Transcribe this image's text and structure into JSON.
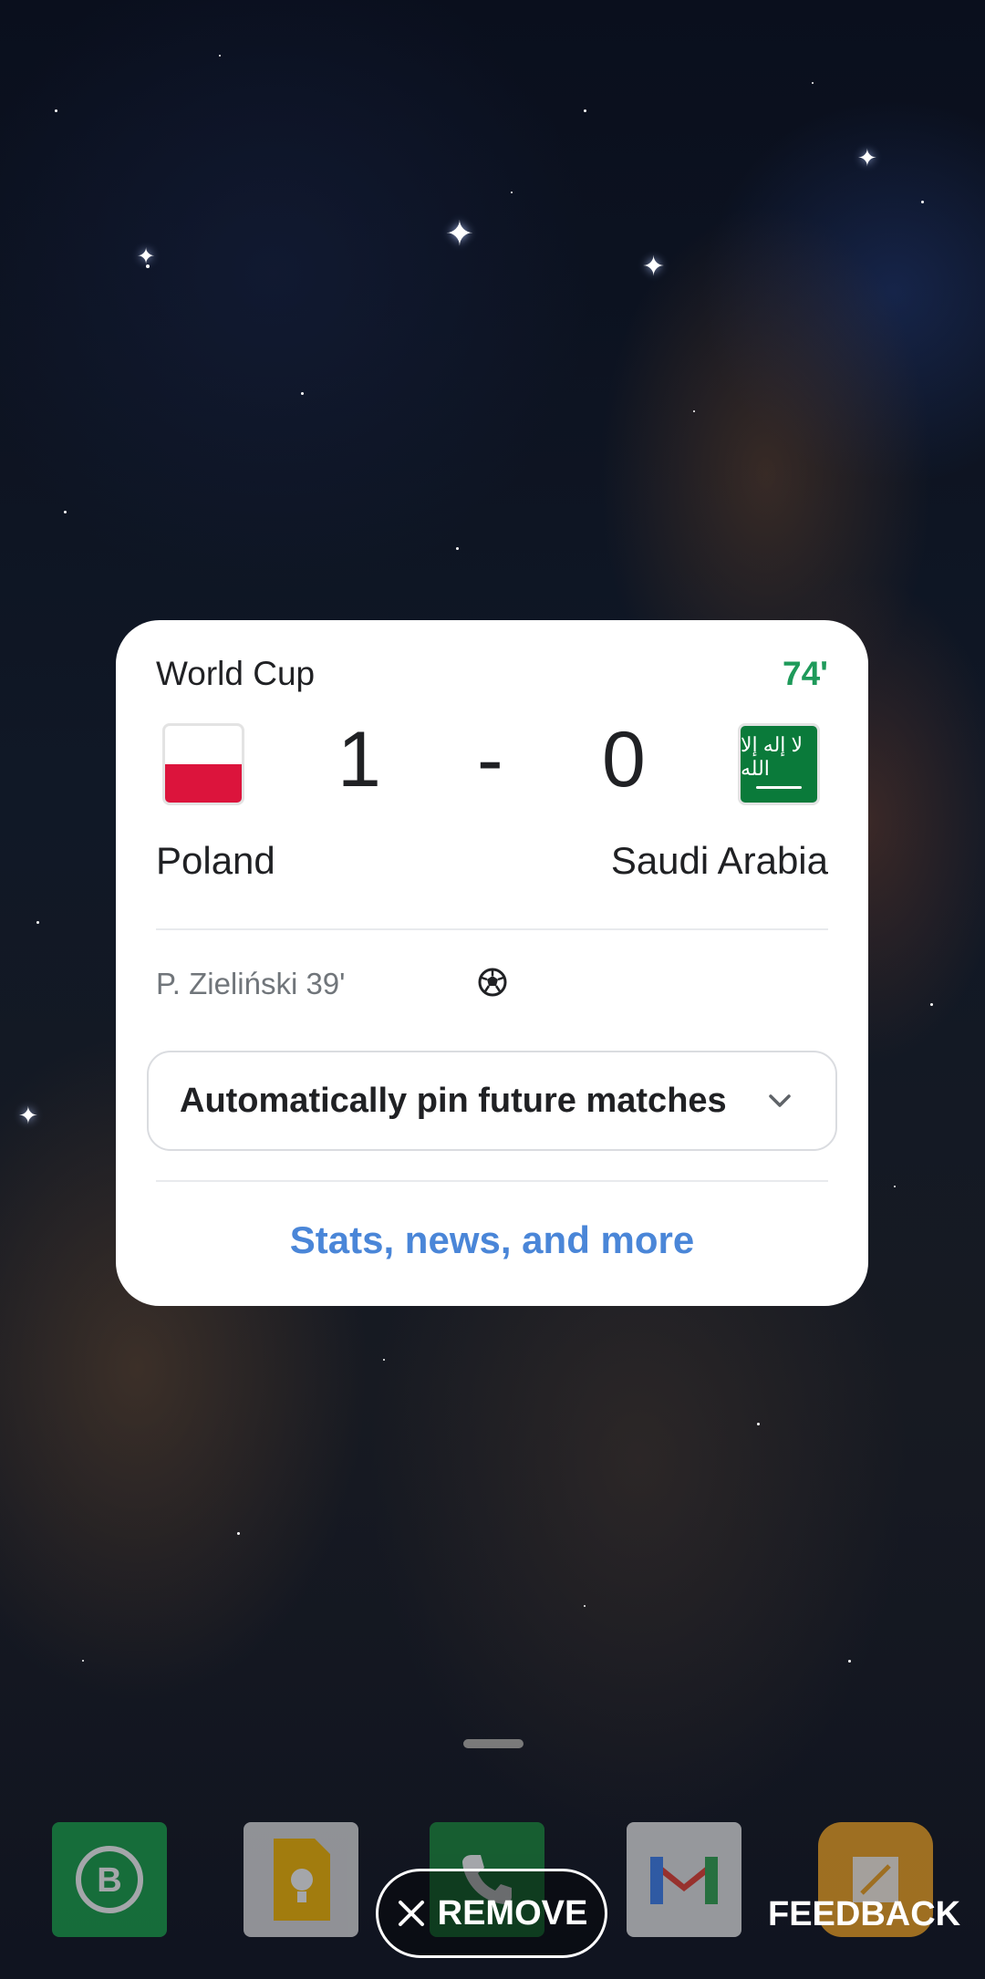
{
  "widget": {
    "league": "World Cup",
    "minute": "74'",
    "home": {
      "team": "Poland",
      "score": "1",
      "flag_icon": "poland-flag-icon"
    },
    "separator": "-",
    "away": {
      "team": "Saudi Arabia",
      "score": "0",
      "flag_icon": "saudi-arabia-flag-icon",
      "flag_script": "لا إله إلا الله"
    },
    "scorer": "P. Zieliński 39'",
    "pin_option": "Automatically pin future matches",
    "more_link": "Stats, news, and more"
  },
  "actions": {
    "remove_label": "REMOVE",
    "feedback_label": "FEEDBACK"
  },
  "dock": [
    "whatsapp-business-icon",
    "google-keep-icon",
    "phone-icon",
    "gmail-icon",
    "notes-icon"
  ],
  "colors": {
    "minute_live": "#1e9a5a",
    "link_blue": "#4a86d8",
    "card_background": "#ffffff"
  }
}
